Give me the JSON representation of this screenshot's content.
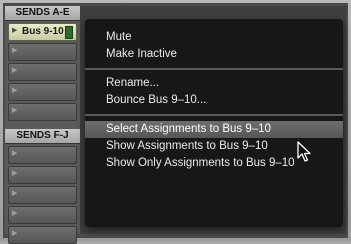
{
  "sends_ae": {
    "header": "SENDS A-E",
    "active_slot": {
      "label": "Bus 9-10"
    }
  },
  "sends_fj": {
    "header": "SENDS F-J"
  },
  "context_menu": {
    "groups": [
      [
        "Mute",
        "Make Inactive"
      ],
      [
        "Rename...",
        "Bounce Bus 9–10..."
      ],
      [
        "Select Assignments to Bus 9–10",
        "Show Assignments to Bus 9–10",
        "Show Only Assignments to Bus 9–10"
      ]
    ],
    "highlighted_item": "Select Assignments to Bus 9–10"
  },
  "icons": {
    "slot_triangle": "▶",
    "cursor": "arrow-pointer-icon"
  }
}
